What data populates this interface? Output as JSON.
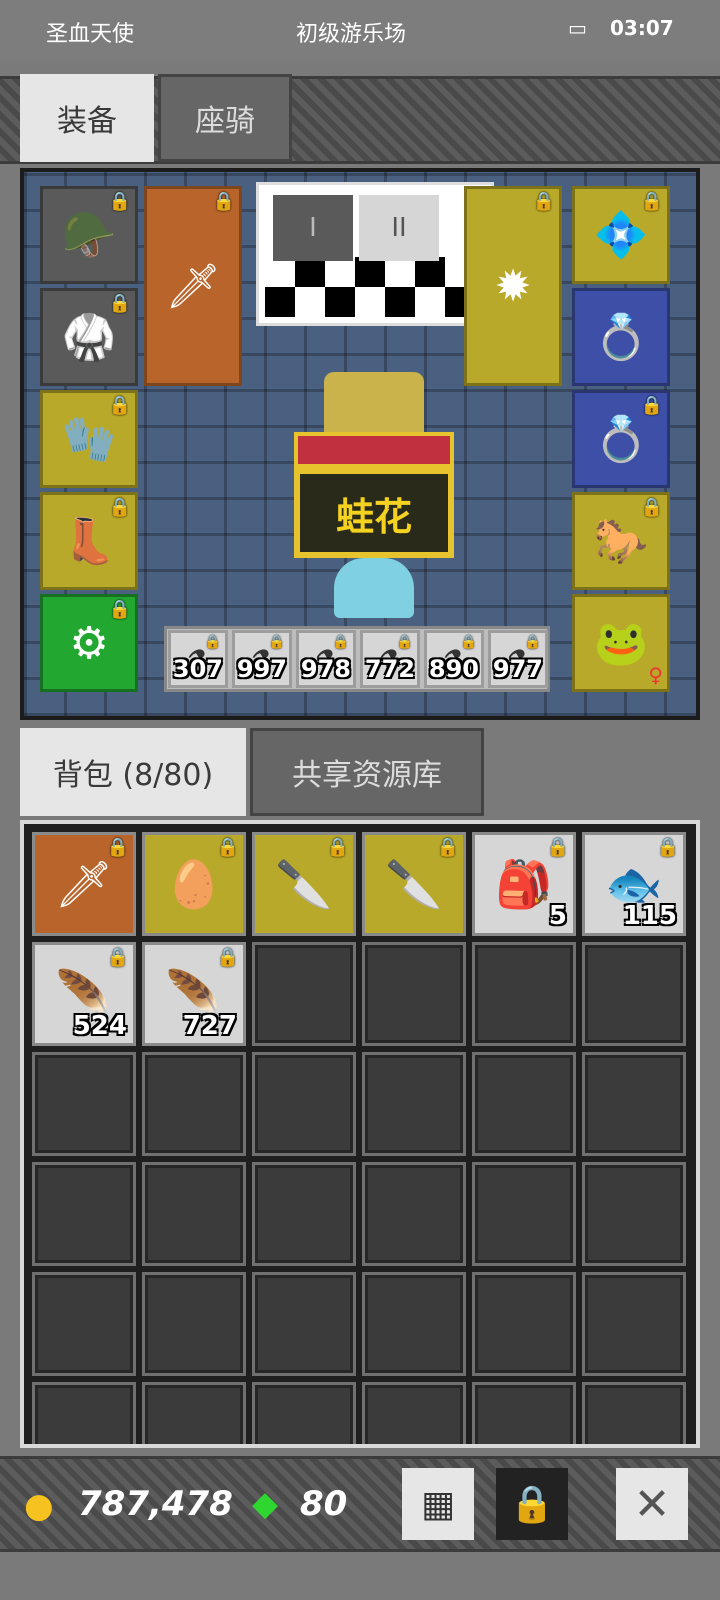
{
  "status_bar": {
    "left": "圣血天使",
    "center": "初级游乐场",
    "time": "03:07"
  },
  "top_tabs": [
    {
      "label": "装备",
      "active": true
    },
    {
      "label": "座骑",
      "active": false
    }
  ],
  "equipment": {
    "pet_name": "蛙花",
    "page_buttons": [
      "I",
      "II"
    ],
    "left_slots": [
      {
        "icon": "horned-helmet-icon",
        "rarity": "gray"
      },
      {
        "icon": "dark-armor-icon",
        "rarity": "gray"
      },
      {
        "icon": "gauntlet-icon",
        "rarity": "yellow"
      },
      {
        "icon": "boots-icon",
        "rarity": "yellow"
      },
      {
        "icon": "belt-icon",
        "rarity": "green"
      }
    ],
    "weapon_slot": {
      "icon": "golden-sword-icon",
      "rarity": "orange"
    },
    "offhand_slot": {
      "icon": "spiked-ball-icon",
      "rarity": "yellow"
    },
    "right_slots": [
      {
        "icon": "amulet-icon",
        "rarity": "yellow"
      },
      {
        "icon": "emerald-ring-icon",
        "rarity": "blue"
      },
      {
        "icon": "amethyst-ring-icon",
        "rarity": "blue"
      },
      {
        "icon": "mount-portrait-icon",
        "rarity": "yellow"
      },
      {
        "icon": "pet-portrait-icon",
        "rarity": "yellow"
      }
    ],
    "potions": [
      {
        "icon": "mixed-potion-icon",
        "count": "307"
      },
      {
        "icon": "cyan-potion-icon",
        "count": "997"
      },
      {
        "icon": "red-potion-icon",
        "count": "978"
      },
      {
        "icon": "blue-potion-icon",
        "count": "772"
      },
      {
        "icon": "red-potion-icon",
        "count": "890"
      },
      {
        "icon": "blue-potion-icon",
        "count": "977"
      }
    ]
  },
  "inventory_tabs": [
    {
      "label": "背包 (8/80)",
      "active": true
    },
    {
      "label": "共享资源库",
      "active": false
    }
  ],
  "inventory": {
    "items": [
      {
        "icon": "golden-sword-icon",
        "rarity": "orange",
        "count": ""
      },
      {
        "icon": "egg-icon",
        "rarity": "yellow",
        "count": ""
      },
      {
        "icon": "dagger-icon",
        "rarity": "yellow",
        "count": ""
      },
      {
        "icon": "dagger-icon",
        "rarity": "yellow",
        "count": ""
      },
      {
        "icon": "green-bag-icon",
        "rarity": "light",
        "count": "5"
      },
      {
        "icon": "fish-icon",
        "rarity": "light",
        "count": "115"
      },
      {
        "icon": "red-feather-icon",
        "rarity": "light",
        "count": "524"
      },
      {
        "icon": "blue-feather-icon",
        "rarity": "light",
        "count": "727"
      }
    ]
  },
  "currency": {
    "gold": "787,478",
    "gems": "80"
  },
  "colors": {
    "gray": "#5a5a5a",
    "yellow": "#b9a92a",
    "orange": "#b8642a",
    "green": "#22a831",
    "blue": "#3e4fa8",
    "light": "#d6d6d6"
  }
}
